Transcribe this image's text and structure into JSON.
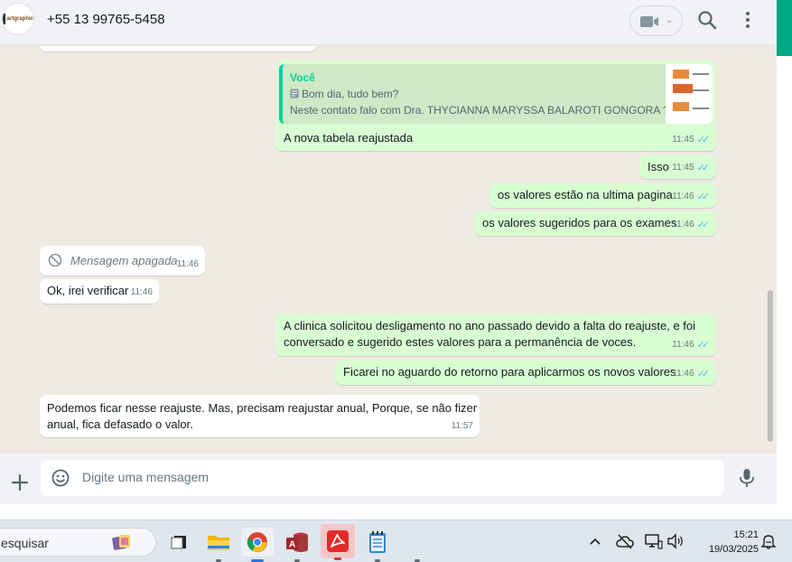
{
  "header": {
    "contact_name": "+55 13 99765-5458",
    "avatar_logo_text": "artgraphic",
    "icons": [
      "video-camera-icon",
      "chevron-down-icon",
      "search-icon",
      "more-vertical-icon"
    ]
  },
  "messages": [
    {
      "direction": "out",
      "quote": {
        "author": "Você",
        "line1": "Bom dia, tudo bem?",
        "line2": "Neste contato falo com Dra. THYCIANNA MARYSSA BALAROTI GONGORA ?..."
      },
      "text": "A nova tabela reajustada",
      "time": "11:45",
      "status": "read"
    },
    {
      "direction": "out",
      "text": "Isso",
      "time": "11:45",
      "status": "read"
    },
    {
      "direction": "out",
      "text": "os valores estão na ultima pagina",
      "time": "11:46",
      "status": "read"
    },
    {
      "direction": "out",
      "text": "os valores sugeridos para os exames",
      "time": "11:46",
      "status": "read"
    },
    {
      "direction": "in",
      "text": "Mensagem apagada",
      "time": "11:46",
      "deleted": true
    },
    {
      "direction": "in",
      "text": "Ok, irei verificar",
      "time": "11:46"
    },
    {
      "direction": "out",
      "line1": "A clinica solicitou desligamento no ano passado devido a falta do reajuste, e foi",
      "line2": "conversado e sugerido estes valores para a permanência de voces.",
      "time": "11:46",
      "status": "read"
    },
    {
      "direction": "out",
      "text": "Ficarei no aguardo do retorno para aplicarmos os novos valores",
      "time": "11:46",
      "status": "read"
    },
    {
      "direction": "in",
      "line1": "Podemos ficar nesse reajuste. Mas, precisam reajustar anual, Porque, se não fizer",
      "line2": "anual, fica defasado o valor.",
      "time": "11:57"
    }
  ],
  "composer": {
    "placeholder": "Digite uma mensagem",
    "icons": [
      "plus-icon",
      "emoji-icon",
      "microphone-icon"
    ]
  },
  "taskbar": {
    "search_text": "esquisar",
    "apps": [
      "task-view",
      "file-explorer",
      "chrome",
      "access",
      "acrobat",
      "notepad"
    ],
    "time": "15:21",
    "date": "19/03/2025"
  },
  "colors": {
    "outgoing_bubble": "#d9fdd3",
    "incoming_bubble": "#ffffff",
    "chat_background": "#efeae2",
    "read_ticks": "#53bdeb",
    "accent": "#00a884"
  }
}
